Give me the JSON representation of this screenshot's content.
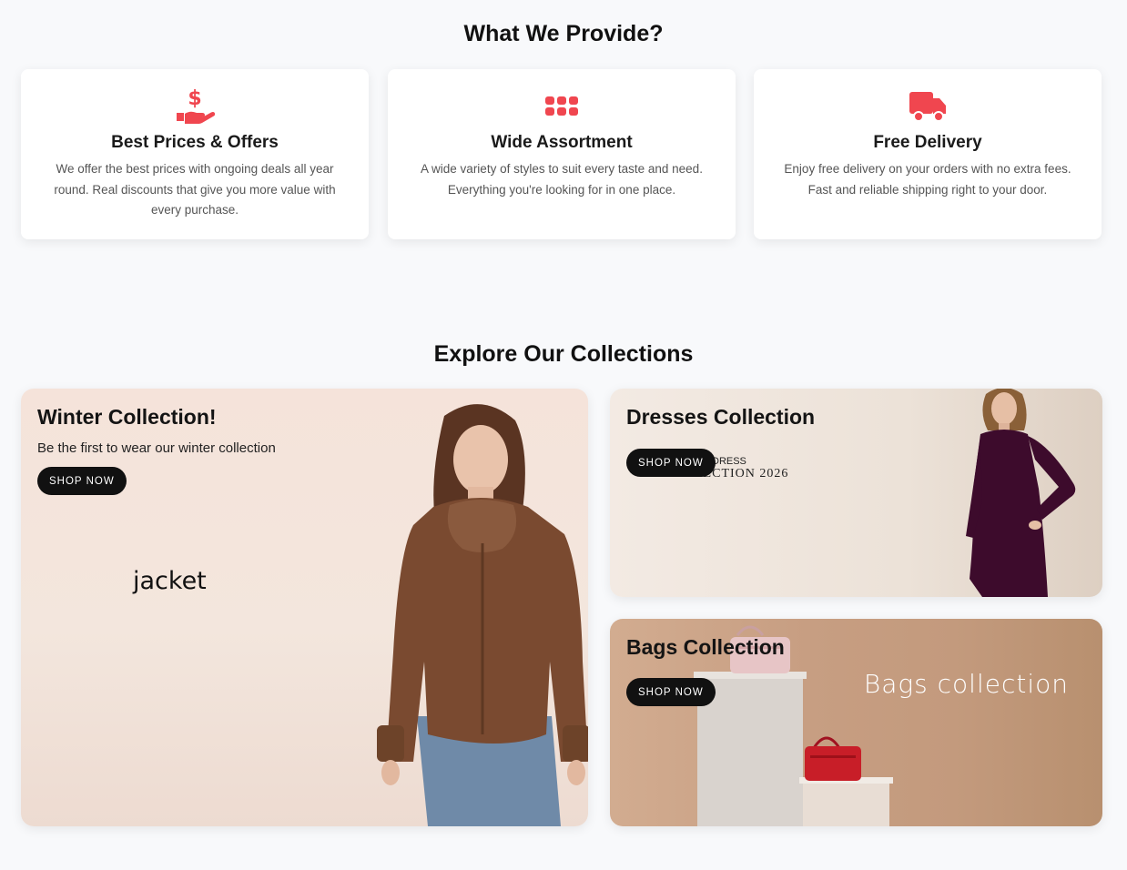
{
  "provide": {
    "title": "What We Provide?",
    "features": [
      {
        "icon": "hand-dollar-icon",
        "title": "Best Prices & Offers",
        "text": "We offer the best prices with ongoing deals all year round. Real discounts that give you more value with every purchase."
      },
      {
        "icon": "grid-icon",
        "title": "Wide Assortment",
        "text": "A wide variety of styles to suit every taste and need. Everything you're looking for in one place."
      },
      {
        "icon": "truck-icon",
        "title": "Free Delivery",
        "text": "Enjoy free delivery on your orders with no extra fees. Fast and reliable shipping right to your door."
      }
    ]
  },
  "collections": {
    "title": "Explore Our Collections",
    "winter": {
      "title": "Winter Collection!",
      "subtitle": "Be the first to wear our winter collection",
      "button": "SHOP NOW",
      "image_text": "jacket"
    },
    "dresses": {
      "title": "Dresses Collection",
      "button": "SHOP NOW",
      "image_text_1": "DRESS",
      "image_text_2": "COLLECTION 2026"
    },
    "bags": {
      "title": "Bags Collection",
      "button": "SHOP NOW",
      "image_text": "Bags collection"
    }
  },
  "colors": {
    "accent": "#f0464f",
    "button": "#111111"
  }
}
